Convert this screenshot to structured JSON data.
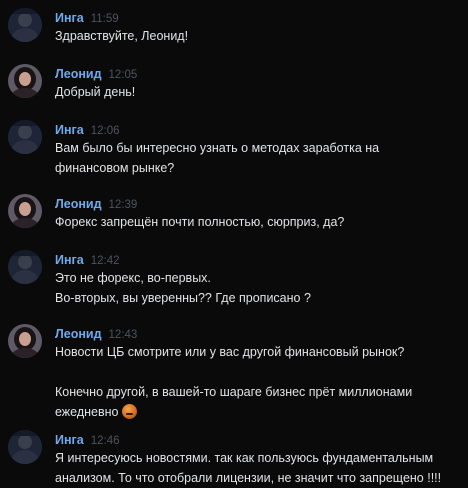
{
  "messages": [
    {
      "author": "Инга",
      "avatar": "avatar-inga",
      "time": "11:59",
      "lines": [
        "Здравствуйте, Леонид!"
      ]
    },
    {
      "author": "Леонид",
      "avatar": "avatar-leonid",
      "time": "12:05",
      "lines": [
        "Добрый день!"
      ]
    },
    {
      "author": "Инга",
      "avatar": "avatar-inga",
      "time": "12:06",
      "lines": [
        "Вам было бы интересно узнать о методах заработка на",
        "финансовом рынке?"
      ]
    },
    {
      "author": "Леонид",
      "avatar": "avatar-leonid",
      "time": "12:39",
      "lines": [
        "Форекс запрещён почти полностью, сюрприз, да?"
      ]
    },
    {
      "author": "Инга",
      "avatar": "avatar-inga",
      "time": "12:42",
      "lines": [
        "Это не форекс, во-первых.",
        "Во-вторых, вы уверенны?? Где прописано ?"
      ]
    },
    {
      "author": "Леонид",
      "avatar": "avatar-leonid",
      "time": "12:43",
      "lines": [
        "Новости ЦБ смотрите или у вас другой финансовый рынок?",
        "",
        "Конечно другой, в вашей-то шараге бизнес прёт миллионами",
        "ежедневно"
      ],
      "emoji": "face-emoji"
    },
    {
      "author": "Инга",
      "avatar": "avatar-inga",
      "time": "12:46",
      "lines": [
        "Я интересуюсь новостями. так как пользуюсь фундаментальным",
        "анализом. То что отобрали лицензии, не значит что запрещено !!!!"
      ]
    }
  ],
  "colors": {
    "background": "#0a0a0a",
    "author": "#71aaeb",
    "time": "#4f535b",
    "text": "#e1e3e6"
  }
}
